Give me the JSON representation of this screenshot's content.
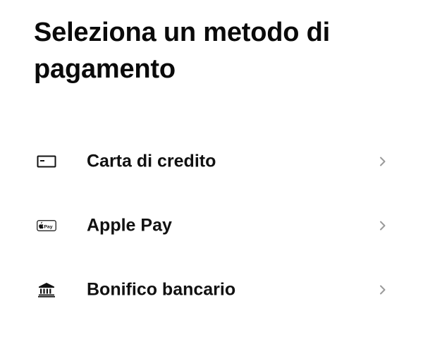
{
  "title": "Seleziona un metodo di pagamento",
  "methods": [
    {
      "label": "Carta di credito",
      "icon": "credit-card-icon"
    },
    {
      "label": "Apple Pay",
      "icon": "apple-pay-icon",
      "icon_text": "Pay"
    },
    {
      "label": "Bonifico bancario",
      "icon": "bank-icon"
    }
  ],
  "colors": {
    "text": "#111111",
    "chevron": "#9a9a9a",
    "background": "#ffffff"
  }
}
